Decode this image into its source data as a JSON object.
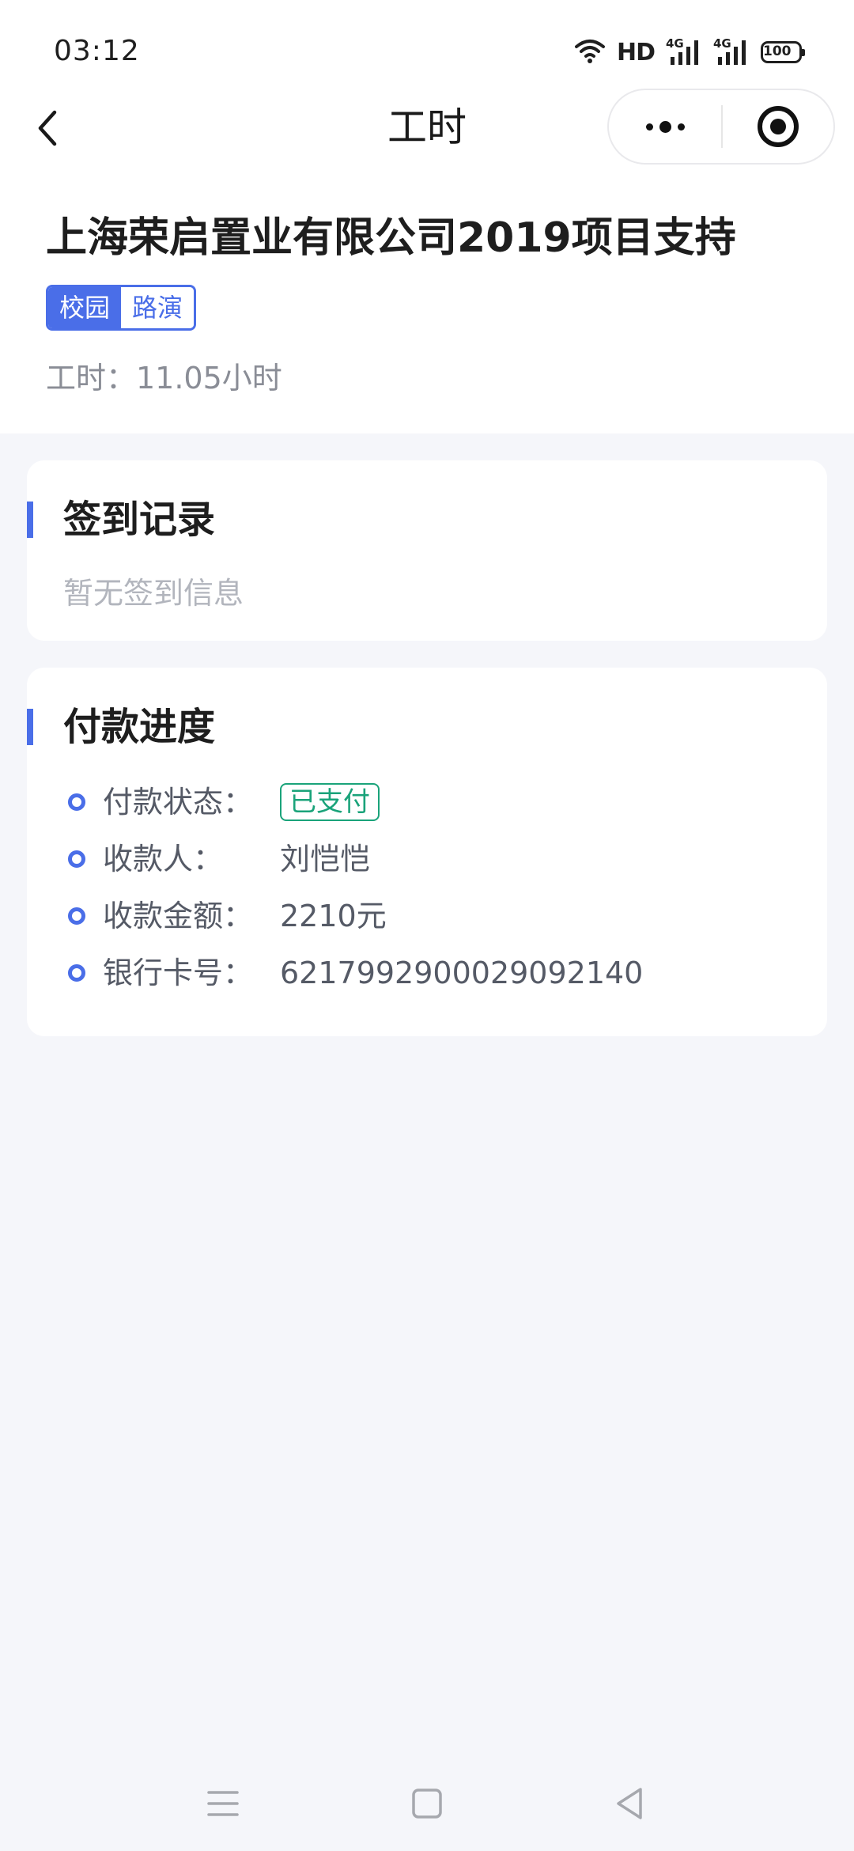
{
  "status_bar": {
    "time": "03:12",
    "hd_label": "HD",
    "signal_1_label": "4G",
    "signal_2_label": "4G",
    "battery_level": "100",
    "icons": [
      "wifi-icon",
      "hd-icon",
      "signal-icon",
      "signal-icon",
      "battery-icon"
    ]
  },
  "nav": {
    "title": "工时",
    "back_icon": "chevron-left-icon",
    "more_icon": "more-dots-icon",
    "close_icon": "target-icon"
  },
  "project": {
    "title": "上海荣启置业有限公司2019项目支持",
    "tags": [
      "校园",
      "路演"
    ],
    "hours_text": "工时：11.05小时"
  },
  "checkin": {
    "title": "签到记录",
    "empty_text": "暂无签到信息"
  },
  "payment": {
    "title": "付款进度",
    "rows": [
      {
        "label": "付款状态：",
        "value": "已支付"
      },
      {
        "label": "收款人：",
        "value": "刘恺恺"
      },
      {
        "label": "收款金额：",
        "value": "2210元"
      },
      {
        "label": "银行卡号：",
        "value": "6217992900029092140"
      }
    ]
  },
  "system_nav": {
    "icons": [
      "menu-icon",
      "home-square-icon",
      "back-triangle-icon"
    ]
  },
  "colors": {
    "accent": "#4a6ee8",
    "paid_green": "#1aa37a",
    "page_bg": "#f5f6fa",
    "muted_text": "#8a8d96"
  }
}
